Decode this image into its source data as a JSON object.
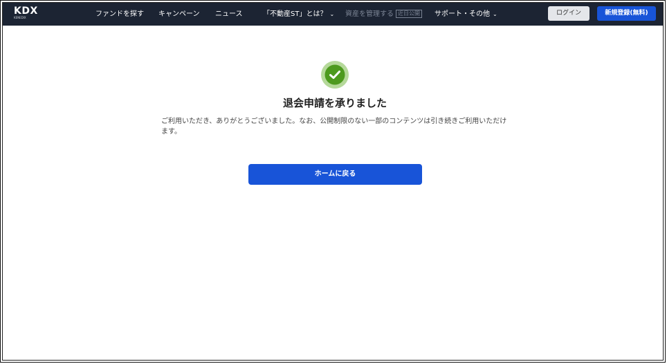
{
  "logo": {
    "text": "KDX",
    "subtext": "KENEDIX"
  },
  "nav": {
    "items": [
      {
        "label": "ファンドを探す",
        "has_dropdown": false
      },
      {
        "label": "キャンペーン",
        "has_dropdown": false
      },
      {
        "label": "ニュース",
        "has_dropdown": false
      },
      {
        "label": "「不動産ST」とは？",
        "has_dropdown": true
      },
      {
        "label": "資産を管理する",
        "badge": "近日公開",
        "disabled": true
      },
      {
        "label": "サポート・その他",
        "has_dropdown": true
      }
    ],
    "login_label": "ログイン",
    "register_label": "新規登録(無料)"
  },
  "main": {
    "title": "退会申請を承りました",
    "message": "ご利用いただき、ありがとうございました。なお、公開制限のない一部のコンテンツは引き続きご利用いただけます。",
    "home_button_label": "ホームに戻る"
  },
  "icons": {
    "chevron": "chevron-down-icon",
    "success": "check-circle-icon"
  },
  "colors": {
    "nav_bg": "#1c2433",
    "primary": "#1854d8",
    "success": "#4d9a1e",
    "success_ring": "#b5d99a"
  }
}
